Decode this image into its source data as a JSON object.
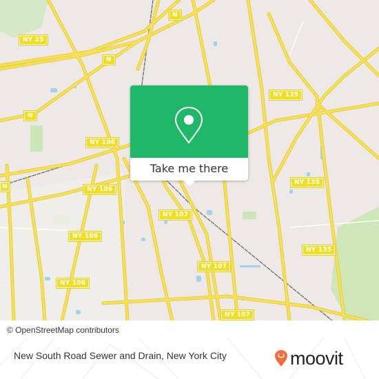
{
  "map": {
    "shields": [
      {
        "label": "NY 25"
      },
      {
        "label": "N"
      },
      {
        "label": "N"
      },
      {
        "label": "N"
      },
      {
        "label": "NY 135"
      },
      {
        "label": "NY 106"
      },
      {
        "label": "NY 106"
      },
      {
        "label": "NY 135"
      },
      {
        "label": "NY 106"
      },
      {
        "label": "NY 107"
      },
      {
        "label": "NY 106"
      },
      {
        "label": "NY 135"
      },
      {
        "label": "NY 107"
      },
      {
        "label": "NY 107"
      },
      {
        "label": "N"
      }
    ],
    "colors": {
      "land": "#eee9e6",
      "road": "#f6e05a",
      "park": "#cde6b5",
      "water": "#9fd3ee",
      "rail": "#777777"
    }
  },
  "popup": {
    "icon": "map-pin-icon",
    "button_label": "Take me there",
    "color": "#1fb869"
  },
  "attribution": "© OpenStreetMap contributors",
  "footer": {
    "place_name": "New South Road Sewer and Drain, New York City",
    "logo_text": "moovit",
    "logo_color": "#f26b3a"
  }
}
